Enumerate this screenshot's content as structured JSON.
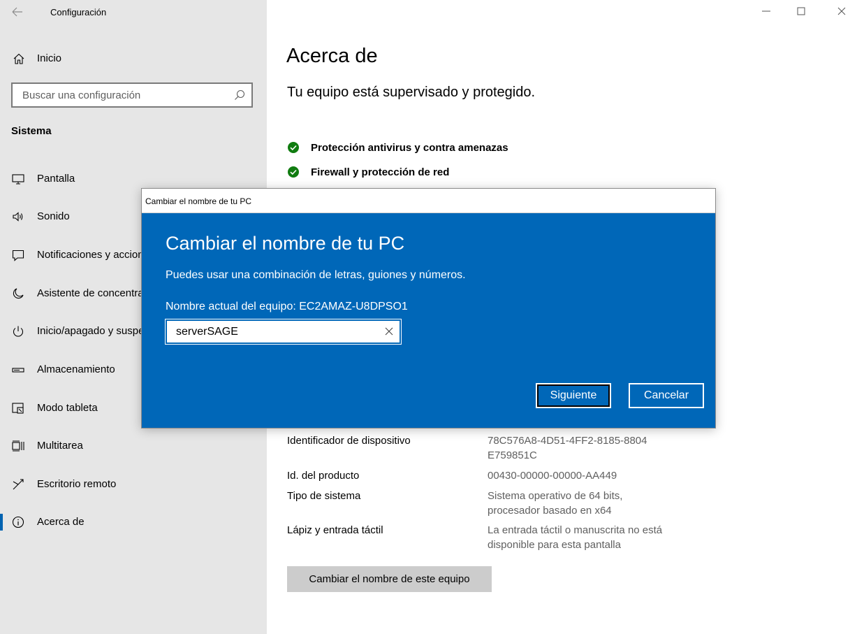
{
  "window": {
    "app_title": "Configuración"
  },
  "sidebar": {
    "home_label": "Inicio",
    "search_placeholder": "Buscar una configuración",
    "section_title": "Sistema",
    "items": [
      {
        "label": "Pantalla",
        "icon": "monitor-icon"
      },
      {
        "label": "Sonido",
        "icon": "speaker-icon"
      },
      {
        "label": "Notificaciones y acciones",
        "icon": "notification-icon"
      },
      {
        "label": "Asistente de concentración",
        "icon": "moon-icon"
      },
      {
        "label": "Inicio/apagado y suspensión",
        "icon": "power-icon"
      },
      {
        "label": "Almacenamiento",
        "icon": "storage-icon"
      },
      {
        "label": "Modo tableta",
        "icon": "tablet-icon"
      },
      {
        "label": "Multitarea",
        "icon": "multitask-icon"
      },
      {
        "label": "Escritorio remoto",
        "icon": "remote-desktop-icon"
      },
      {
        "label": "Acerca de",
        "icon": "info-icon",
        "selected": true
      }
    ]
  },
  "main": {
    "title": "Acerca de",
    "protection_heading": "Tu equipo está supervisado y protegido.",
    "status": [
      {
        "label": "Protección antivirus y contra amenazas"
      },
      {
        "label": "Firewall y protección de red"
      }
    ],
    "specs": [
      {
        "label": "Identificador de dispositivo",
        "value": "78C576A8-4D51-4FF2-8185-8804 E759851C"
      },
      {
        "label": "Id. del producto",
        "value": "00430-00000-00000-AA449"
      },
      {
        "label": "Tipo de sistema",
        "value": "Sistema operativo de 64 bits, procesador basado en x64"
      },
      {
        "label": "Lápiz y entrada táctil",
        "value": "La entrada táctil o manuscrita no está disponible para esta pantalla"
      }
    ],
    "rename_button": "Cambiar el nombre de este equipo"
  },
  "dialog": {
    "window_title": "Cambiar el nombre de tu PC",
    "heading": "Cambiar el nombre de tu PC",
    "description": "Puedes usar una combinación de letras, guiones y números.",
    "current_name": "Nombre actual del equipo: EC2AMAZ-U8DPSO1",
    "input_value": "serverSAGE",
    "next_button": "Siguiente",
    "cancel_button": "Cancelar"
  },
  "colors": {
    "accent": "#0067b8",
    "sidebar_bg": "#e6e6e6",
    "success": "#107c10"
  }
}
